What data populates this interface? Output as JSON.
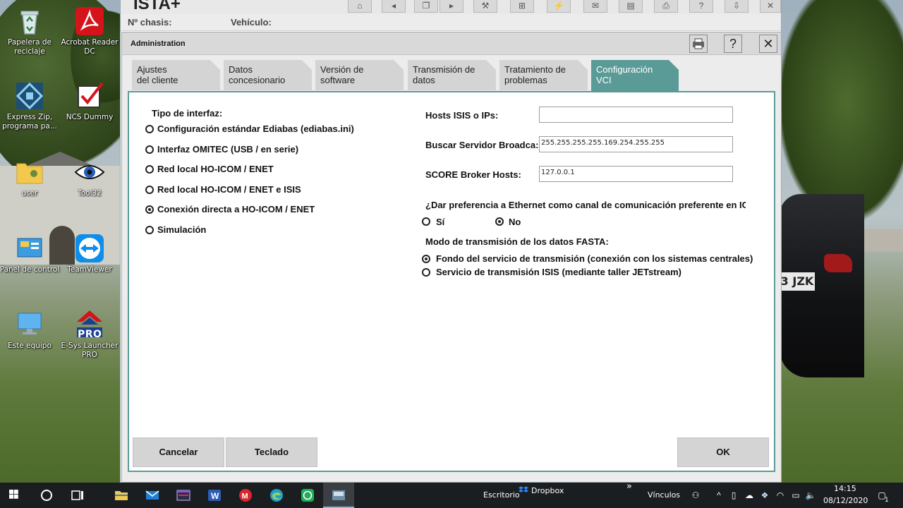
{
  "desktop": {
    "icons": [
      {
        "label": "Papelera de reciclaje"
      },
      {
        "label": "Acrobat Reader DC"
      },
      {
        "label": "Express Zip, programa pa..."
      },
      {
        "label": "NCS Dummy"
      },
      {
        "label": "user"
      },
      {
        "label": "Tool32"
      },
      {
        "label": "Panel de control"
      },
      {
        "label": "TeamViewer"
      },
      {
        "label": "Este equipo"
      },
      {
        "label": "E-Sys Launcher PRO"
      }
    ],
    "plate_text": "3 JZK",
    "e_sys_badge": "PRO"
  },
  "ista": {
    "app_title": "ISTA+",
    "chasis_label": "Nº chasis:",
    "vehiculo_label": "Vehículo:"
  },
  "dialog": {
    "title": "Administration",
    "help_label": "?",
    "close_label": "✕",
    "tabs": [
      {
        "label": "Ajustes\ndel cliente"
      },
      {
        "label": "Datos\nconcesionario"
      },
      {
        "label": "Versión de\nsoftware"
      },
      {
        "label": "Transmisión de\ndatos"
      },
      {
        "label": "Tratamiento de\nproblemas"
      },
      {
        "label": "Configuración\nVCI"
      }
    ],
    "active_tab": "Configuración VCI",
    "interface": {
      "label": "Tipo de interfaz:",
      "options": [
        {
          "label": "Configuración estándar Ediabas (ediabas.ini)",
          "selected": false
        },
        {
          "label": "Interfaz OMITEC (USB / en serie)",
          "selected": false
        },
        {
          "label": "Red local HO-ICOM / ENET",
          "selected": false
        },
        {
          "label": "Red local HO-ICOM / ENET e ISIS",
          "selected": false
        },
        {
          "label": "Conexión directa a HO-ICOM / ENET",
          "selected": true
        },
        {
          "label": "Simulación",
          "selected": false
        }
      ]
    },
    "hosts": {
      "isis_label": "Hosts ISIS o IPs:",
      "isis_value": "",
      "broadcast_label": "Buscar Servidor Broadca:",
      "broadcast_value": "255.255.255.255.169.254.255.255",
      "score_label": "SCORE Broker Hosts:",
      "score_value": "127.0.0.1"
    },
    "ethernet": {
      "question": "¿Dar preferencia a Ethernet como canal de comunicación preferente en IC",
      "yes_label": "Sí",
      "no_label": "No",
      "selected": "No"
    },
    "fasta": {
      "label": "Modo de transmisión de los datos FASTA:",
      "options": [
        {
          "label": "Fondo del servicio de transmisión (conexión con los sistemas centrales)",
          "selected": true
        },
        {
          "label": "Servicio de transmisión ISIS (mediante taller JETstream)",
          "selected": false
        }
      ]
    },
    "buttons": {
      "cancel": "Cancelar",
      "keyboard": "Teclado",
      "ok": "OK"
    }
  },
  "taskbar": {
    "escritorio": "Escritorio",
    "dropbox": "Dropbox",
    "chevron": "»",
    "vinculos": "Vínculos",
    "time": "14:15",
    "date": "08/12/2020",
    "notifications": "1",
    "accent": "#1b1e21"
  }
}
